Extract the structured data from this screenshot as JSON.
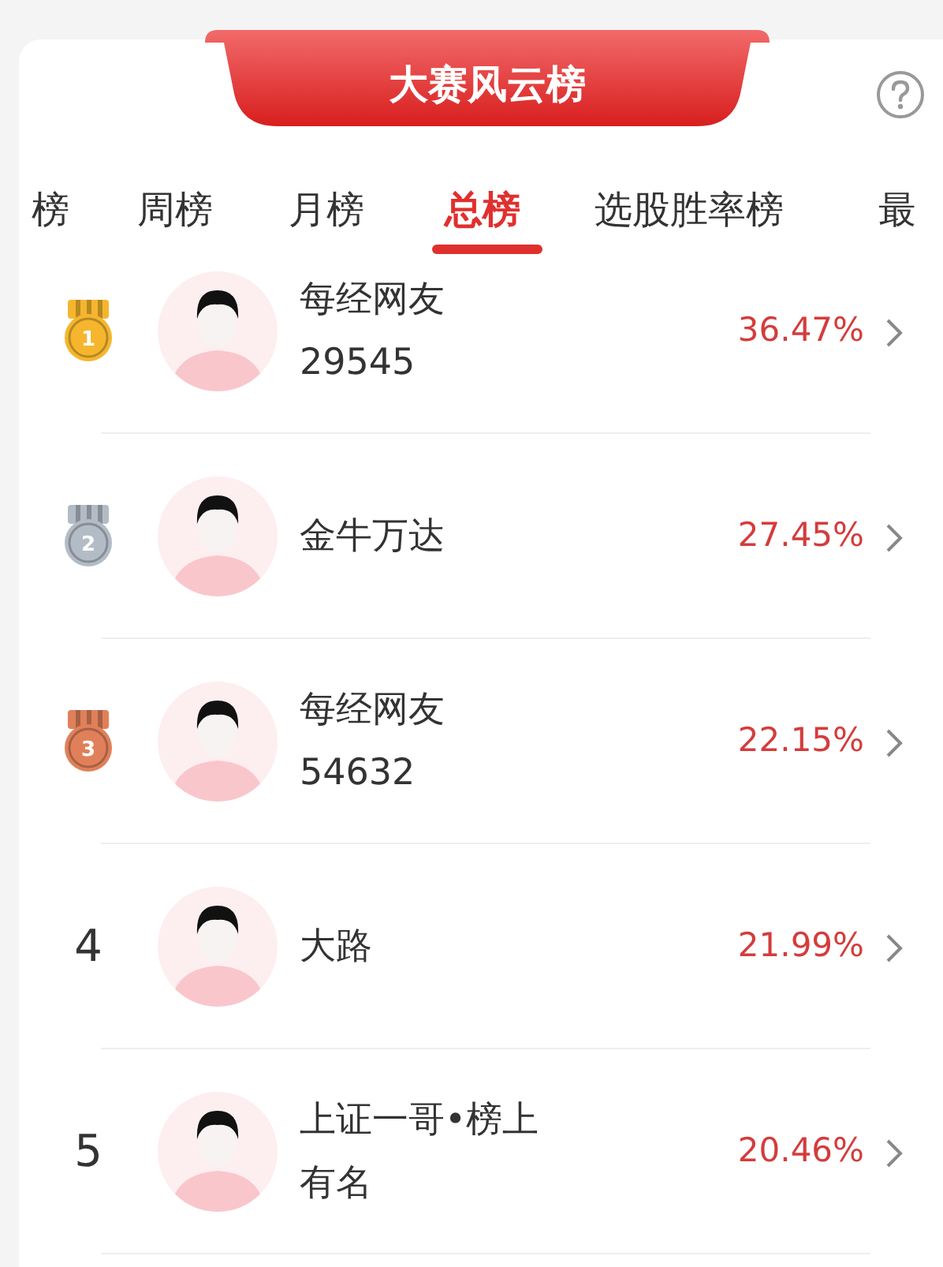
{
  "header": {
    "title": "大赛风云榜"
  },
  "tabs": [
    {
      "label": "榜",
      "selected": false
    },
    {
      "label": "周榜",
      "selected": false
    },
    {
      "label": "月榜",
      "selected": false
    },
    {
      "label": "总榜",
      "selected": true
    },
    {
      "label": "选股胜率榜",
      "selected": false
    },
    {
      "label": "最",
      "selected": false
    }
  ],
  "rows": [
    {
      "kind": "medal",
      "color": "#f5b62e",
      "rank": "1",
      "name_lines": [
        "每经网友",
        "29545"
      ],
      "return": "36.47%"
    },
    {
      "kind": "medal",
      "color": "#b3bcc6",
      "rank": "2",
      "name_lines": [
        "金牛万达"
      ],
      "return": "27.45%"
    },
    {
      "kind": "medal",
      "color": "#e0805a",
      "rank": "3",
      "name_lines": [
        "每经网友",
        "54632"
      ],
      "return": "22.15%"
    },
    {
      "kind": "number",
      "rank": "4",
      "name_lines": [
        "大路"
      ],
      "return": "21.99%"
    },
    {
      "kind": "number",
      "rank": "5",
      "name_lines": [
        "上证一哥•榜上",
        "有名"
      ],
      "return": "20.46%"
    }
  ]
}
